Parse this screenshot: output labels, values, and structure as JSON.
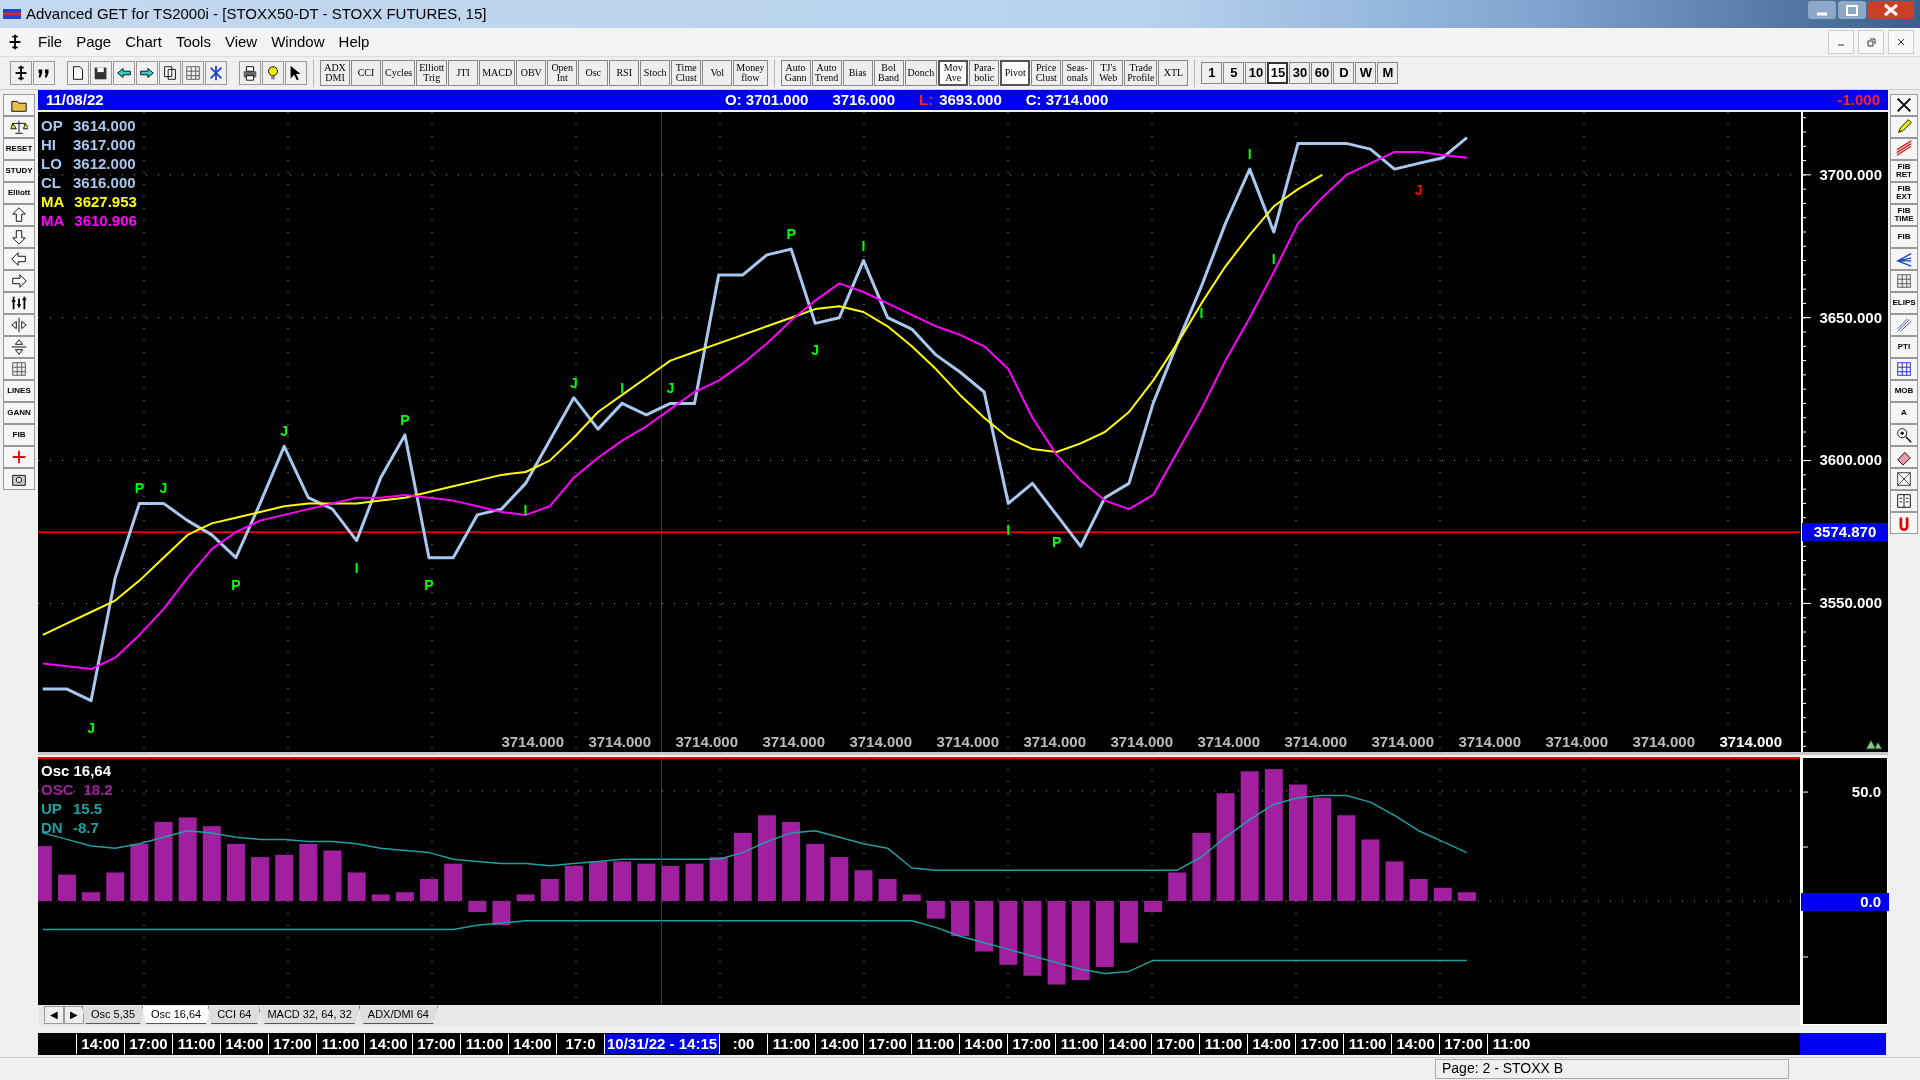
{
  "window": {
    "title": "Advanced GET for TS2000i - [STOXX50-DT - STOXX FUTURES, 15]"
  },
  "menu": [
    "File",
    "Page",
    "Chart",
    "Tools",
    "View",
    "Window",
    "Help"
  ],
  "toolbar": {
    "icon_buttons": [
      {
        "kind": "cursor"
      },
      {
        "kind": "quote"
      },
      {
        "kind": "sep"
      },
      {
        "kind": "page"
      },
      {
        "kind": "save"
      },
      {
        "kind": "back"
      },
      {
        "kind": "forward"
      },
      {
        "kind": "copy"
      },
      {
        "kind": "grid"
      },
      {
        "kind": "net"
      },
      {
        "kind": "sep"
      },
      {
        "kind": "printer"
      },
      {
        "kind": "bulb"
      },
      {
        "kind": "pointer"
      }
    ],
    "indicator_buttons": [
      {
        "label": "ADX\nDMI",
        "selected": false
      },
      {
        "label": "CCI",
        "selected": false
      },
      {
        "label": "Cycles",
        "selected": false
      },
      {
        "label": "Elliott\nTrig",
        "selected": false
      },
      {
        "label": "JTI",
        "selected": false
      },
      {
        "label": "MACD",
        "selected": false
      },
      {
        "label": "OBV",
        "selected": false
      },
      {
        "label": "Open\nInt",
        "selected": false
      },
      {
        "label": "Osc",
        "selected": false
      },
      {
        "label": "RSI",
        "selected": false
      },
      {
        "label": "Stoch",
        "selected": false
      },
      {
        "label": "Time\nClust",
        "selected": false
      },
      {
        "label": "Vol",
        "selected": false
      },
      {
        "label": "Money\nflow",
        "selected": false
      }
    ],
    "study_buttons": [
      {
        "label": "Auto\nGann",
        "selected": false
      },
      {
        "label": "Auto\nTrend",
        "selected": false
      },
      {
        "label": "Bias",
        "selected": false
      },
      {
        "label": "Bol\nBand",
        "selected": false
      },
      {
        "label": "Donch",
        "selected": false
      },
      {
        "label": "Mov\nAve",
        "selected": true
      },
      {
        "label": "Para-\nbolic",
        "selected": false
      },
      {
        "label": "Pivot",
        "selected": true
      },
      {
        "label": "Price\nClust",
        "selected": false
      },
      {
        "label": "Seas-\nonals",
        "selected": false
      },
      {
        "label": "TJ's\nWeb",
        "selected": false
      },
      {
        "label": "Trade\nProfile",
        "selected": false
      },
      {
        "label": "XTL",
        "selected": false
      }
    ],
    "periods": [
      {
        "label": "1",
        "selected": false
      },
      {
        "label": "5",
        "selected": false
      },
      {
        "label": "10",
        "selected": false
      },
      {
        "label": "15",
        "selected": true
      },
      {
        "label": "30",
        "selected": false
      },
      {
        "label": "60",
        "selected": false
      },
      {
        "label": "D",
        "selected": false
      },
      {
        "label": "W",
        "selected": false
      },
      {
        "label": "M",
        "selected": false
      }
    ]
  },
  "left_tools": [
    {
      "kind": "folder"
    },
    {
      "kind": "scales"
    },
    {
      "kind": "label",
      "label": "RESET"
    },
    {
      "kind": "label",
      "label": "STUDY"
    },
    {
      "kind": "label",
      "label": "Elliott"
    },
    {
      "kind": "arrow-up"
    },
    {
      "kind": "arrow-down"
    },
    {
      "kind": "arrow-left"
    },
    {
      "kind": "arrow-right"
    },
    {
      "kind": "bars"
    },
    {
      "kind": "split"
    },
    {
      "kind": "squeeze"
    },
    {
      "kind": "grid"
    },
    {
      "kind": "label",
      "label": "LINES"
    },
    {
      "kind": "label",
      "label": "GANN"
    },
    {
      "kind": "label",
      "label": "FIB"
    },
    {
      "kind": "cross"
    },
    {
      "kind": "camera"
    }
  ],
  "right_tools": [
    {
      "kind": "close-x"
    },
    {
      "kind": "pencil"
    },
    {
      "kind": "lines"
    },
    {
      "kind": "label",
      "label": "FIB\nRET"
    },
    {
      "kind": "label",
      "label": "FIB\nEXT"
    },
    {
      "kind": "label",
      "label": "FIB\nTIME"
    },
    {
      "kind": "label",
      "label": "FIB"
    },
    {
      "kind": "fan"
    },
    {
      "kind": "grid"
    },
    {
      "kind": "label",
      "label": "ELIPS"
    },
    {
      "kind": "pitchfork"
    },
    {
      "kind": "label",
      "label": "PTI"
    },
    {
      "kind": "table"
    },
    {
      "kind": "label",
      "label": "MOB"
    },
    {
      "kind": "label",
      "label": "A"
    },
    {
      "kind": "zoom"
    },
    {
      "kind": "eraser"
    },
    {
      "kind": "pattern"
    },
    {
      "kind": "book"
    },
    {
      "kind": "magnet"
    }
  ],
  "header": {
    "date": "11/08/22",
    "open": "O: 3701.000",
    "high": "3716.000",
    "low_label": "L:",
    "low": "3693.000",
    "close": "C: 3714.000",
    "change": "-1.000"
  },
  "price_chart": {
    "ohlc": [
      {
        "label": "OP",
        "value": "3614.000"
      },
      {
        "label": "HI",
        "value": "3617.000"
      },
      {
        "label": "LO",
        "value": "3612.000"
      },
      {
        "label": "CL",
        "value": "3616.000"
      }
    ],
    "averages": [
      {
        "label": "MA",
        "value": "3627.953"
      },
      {
        "label": "MA",
        "value": "3610.906"
      }
    ],
    "value_row": [
      "3714.000",
      "3714.000",
      "3714.000",
      "3714.000",
      "3714.000",
      "3714.000",
      "3714.000",
      "3714.000",
      "3714.000",
      "3714.000",
      "3714.000",
      "3714.000",
      "3714.000",
      "3714.000",
      "3714.000"
    ],
    "pivot_marks": [
      {
        "text": "J",
        "color": "#00ff00"
      },
      {
        "text": "P",
        "color": "#00ff00"
      },
      {
        "text": "J",
        "color": "#00ff00"
      },
      {
        "text": "P",
        "color": "#00ff00"
      },
      {
        "text": "J",
        "color": "#00ff00"
      },
      {
        "text": "I",
        "color": "#00ff00"
      },
      {
        "text": "P",
        "color": "#00ff00"
      },
      {
        "text": "P",
        "color": "#00ff00"
      },
      {
        "text": "I",
        "color": "#00ff00"
      },
      {
        "text": "J",
        "color": "#00ff00"
      },
      {
        "text": "I",
        "color": "#00ff00"
      },
      {
        "text": "J",
        "color": "#00ff00"
      },
      {
        "text": "P",
        "color": "#00ff00"
      },
      {
        "text": "J",
        "color": "#00ff00"
      },
      {
        "text": "I",
        "color": "#00ff00"
      },
      {
        "text": "I",
        "color": "#00ff00"
      },
      {
        "text": "P",
        "color": "#00ff00"
      },
      {
        "text": "I",
        "color": "#00ff00"
      },
      {
        "text": "I",
        "color": "#00ff00"
      },
      {
        "text": "I",
        "color": "#00ff00"
      },
      {
        "text": "J",
        "color": "#ff0000"
      }
    ],
    "chart_data": {
      "type": "line",
      "ylim": [
        3498,
        3722
      ],
      "grid": true,
      "yticks": [
        {
          "value": 3550,
          "label": "3550.000"
        },
        {
          "value": 3600,
          "label": "3600.000"
        },
        {
          "value": 3650,
          "label": "3650.000"
        },
        {
          "value": 3700,
          "label": "3700.000"
        }
      ],
      "ref_lines": [
        {
          "axis": "y",
          "value": 3574.87,
          "label": "3574.870"
        }
      ],
      "series": [
        {
          "color": "#a8c8f0",
          "values": [
            3520,
            3520,
            3516,
            3559,
            3585,
            3585,
            3579,
            3574,
            3566,
            3585,
            3605,
            3587,
            3583,
            3572,
            3594,
            3609,
            3566,
            3566,
            3581,
            3583,
            3592,
            3607,
            3622,
            3611,
            3620,
            3616,
            3620,
            3620,
            3665,
            3665,
            3672,
            3674,
            3648,
            3650,
            3670,
            3650,
            3646,
            3637,
            3631,
            3624,
            3585,
            3592,
            3581,
            3570,
            3587,
            3592,
            3620,
            3641,
            3661,
            3683,
            3702,
            3680,
            3711,
            3711,
            3711,
            3709,
            3702,
            3704,
            3706,
            3713,
            null,
            null,
            null,
            null,
            null,
            null,
            null,
            null,
            null,
            null,
            null,
            null,
            null
          ]
        },
        {
          "color": "#ffff00",
          "values": [
            3539,
            3543,
            3547,
            3551,
            3558,
            3566,
            3574,
            3578,
            3580,
            3582,
            3584,
            3585,
            3585,
            3585,
            3586,
            3587,
            3589,
            3591,
            3593,
            3595,
            3596,
            3600,
            3608,
            3617,
            3623,
            3629,
            3635,
            3638,
            3641,
            3644,
            3647,
            3650,
            3653,
            3654,
            3652,
            3647,
            3640,
            3632,
            3623,
            3615,
            3608,
            3604,
            3603,
            3606,
            3610,
            3617,
            3628,
            3641,
            3655,
            3668,
            3679,
            3689,
            3695,
            3700,
            null,
            null,
            null,
            null,
            null,
            null,
            null,
            null,
            null,
            null,
            null,
            null,
            null,
            null,
            null,
            null,
            null,
            null,
            null
          ]
        },
        {
          "color": "#ff00ff",
          "values": [
            3529,
            3528,
            3527,
            3531,
            3539,
            3548,
            3559,
            3569,
            3575,
            3579,
            3581,
            3583,
            3585,
            3587,
            3587,
            3588,
            3587,
            3586,
            3584,
            3582,
            3581,
            3584,
            3594,
            3601,
            3607,
            3612,
            3618,
            3624,
            3628,
            3634,
            3641,
            3649,
            3656,
            3662,
            3659,
            3655,
            3651,
            3647,
            3644,
            3640,
            3632,
            3615,
            3602,
            3593,
            3586,
            3583,
            3588,
            3603,
            3618,
            3635,
            3650,
            3666,
            3683,
            3692,
            3700,
            3704,
            3708,
            3708,
            3707,
            3706,
            null,
            null,
            null,
            null,
            null,
            null,
            null,
            null,
            null,
            null,
            null,
            null,
            null
          ]
        }
      ]
    }
  },
  "osc_chart": {
    "title": "Osc 16,64",
    "readings": [
      {
        "label": "OSC",
        "value": "18.2"
      },
      {
        "label": "UP",
        "value": "15.5"
      },
      {
        "label": "DN",
        "value": "-8.7"
      }
    ],
    "chart_data": {
      "type": "bar",
      "ylim": [
        -47.3,
        65.5
      ],
      "grid": true,
      "yticks": [
        {
          "value": 0,
          "label": "0.0"
        },
        {
          "value": 50,
          "label": "50.0"
        }
      ],
      "series": [
        {
          "color": "#a0209f",
          "values": [
            25,
            12,
            4,
            13,
            26,
            36,
            38,
            34,
            26,
            20,
            21,
            26,
            23,
            13,
            3,
            4,
            10,
            17,
            -5,
            -11,
            3,
            10,
            16,
            18,
            18,
            17,
            16,
            17,
            20,
            31,
            39,
            36,
            26,
            20,
            14,
            10,
            3,
            -8,
            -16,
            -23,
            -29,
            -34,
            -38,
            -36,
            -30,
            -19,
            -5,
            13,
            31,
            49,
            59,
            60,
            53,
            47,
            39,
            28,
            18,
            10,
            6,
            4,
            null,
            null,
            null,
            null,
            null,
            null,
            null,
            null,
            null,
            null,
            null,
            null,
            null
          ]
        },
        {
          "color": "#20a0a0",
          "type": "line",
          "values": [
            31,
            28,
            25,
            24,
            26,
            29,
            32,
            31,
            29,
            28,
            28,
            27,
            27,
            26,
            24,
            23,
            22,
            19,
            18,
            17,
            17,
            16,
            17,
            18,
            19,
            19,
            19,
            19,
            19,
            22,
            27,
            31,
            32,
            29,
            26,
            24,
            15,
            14,
            14,
            14,
            14,
            14,
            14,
            14,
            14,
            14,
            14,
            14,
            20,
            29,
            37,
            44,
            47,
            48,
            48,
            45,
            39,
            32,
            27,
            22,
            null,
            null,
            null,
            null,
            null,
            null,
            null,
            null,
            null,
            null,
            null,
            null,
            null
          ]
        },
        {
          "color": "#20a0a0",
          "type": "line",
          "values": [
            -13,
            -13,
            -13,
            -13,
            -13,
            -13,
            -13,
            -13,
            -13,
            -13,
            -13,
            -13,
            -13,
            -13,
            -13,
            -13,
            -13,
            -13,
            -11,
            -10,
            -9,
            -9,
            -9,
            -9,
            -9,
            -9,
            -9,
            -9,
            -9,
            -9,
            -9,
            -9,
            -9,
            -9,
            -9,
            -9,
            -9,
            -12,
            -16,
            -19,
            -22,
            -25,
            -28,
            -31,
            -33,
            -32,
            -27,
            -27,
            -27,
            -27,
            -27,
            -27,
            -27,
            -27,
            -27,
            -27,
            -27,
            -27,
            -27,
            -27,
            null,
            null,
            null,
            null,
            null,
            null,
            null,
            null,
            null,
            null,
            null,
            null,
            null
          ]
        }
      ]
    }
  },
  "tabs": {
    "scroll_buttons": [
      "◀",
      "▶"
    ],
    "items": [
      {
        "label": "Osc 5,35",
        "selected": false
      },
      {
        "label": "Osc 16,64",
        "selected": true
      },
      {
        "label": "CCI 64",
        "selected": false
      },
      {
        "label": "MACD 32, 64, 32",
        "selected": false
      },
      {
        "label": "ADX/DMI 64",
        "selected": false
      }
    ]
  },
  "time_axis": [
    {
      "text": "14:00",
      "selected": false
    },
    {
      "text": "17:00",
      "selected": false
    },
    {
      "text": "11:00",
      "selected": false
    },
    {
      "text": "14:00",
      "selected": false
    },
    {
      "text": "17:00",
      "selected": false
    },
    {
      "text": "11:00",
      "selected": false
    },
    {
      "text": "14:00",
      "selected": false
    },
    {
      "text": "17:00",
      "selected": false
    },
    {
      "text": "11:00",
      "selected": false
    },
    {
      "text": "14:00",
      "selected": false
    },
    {
      "text": "17:0",
      "selected": false
    },
    {
      "text": "10/31/22 - 14:15",
      "selected": true
    },
    {
      "text": ":00",
      "selected": false
    },
    {
      "text": "11:00",
      "selected": false
    },
    {
      "text": "14:00",
      "selected": false
    },
    {
      "text": "17:00",
      "selected": false
    },
    {
      "text": "11:00",
      "selected": false
    },
    {
      "text": "14:00",
      "selected": false
    },
    {
      "text": "17:00",
      "selected": false
    },
    {
      "text": "11:00",
      "selected": false
    },
    {
      "text": "14:00",
      "selected": false
    },
    {
      "text": "17:00",
      "selected": false
    },
    {
      "text": "11:00",
      "selected": false
    },
    {
      "text": "14:00",
      "selected": false
    },
    {
      "text": "17:00",
      "selected": false
    },
    {
      "text": "11:00",
      "selected": false
    },
    {
      "text": "14:00",
      "selected": false
    },
    {
      "text": "17:00",
      "selected": false
    },
    {
      "text": "11:00",
      "selected": false
    }
  ],
  "status_bar": {
    "page": "Page: 2 - STOXX B"
  }
}
